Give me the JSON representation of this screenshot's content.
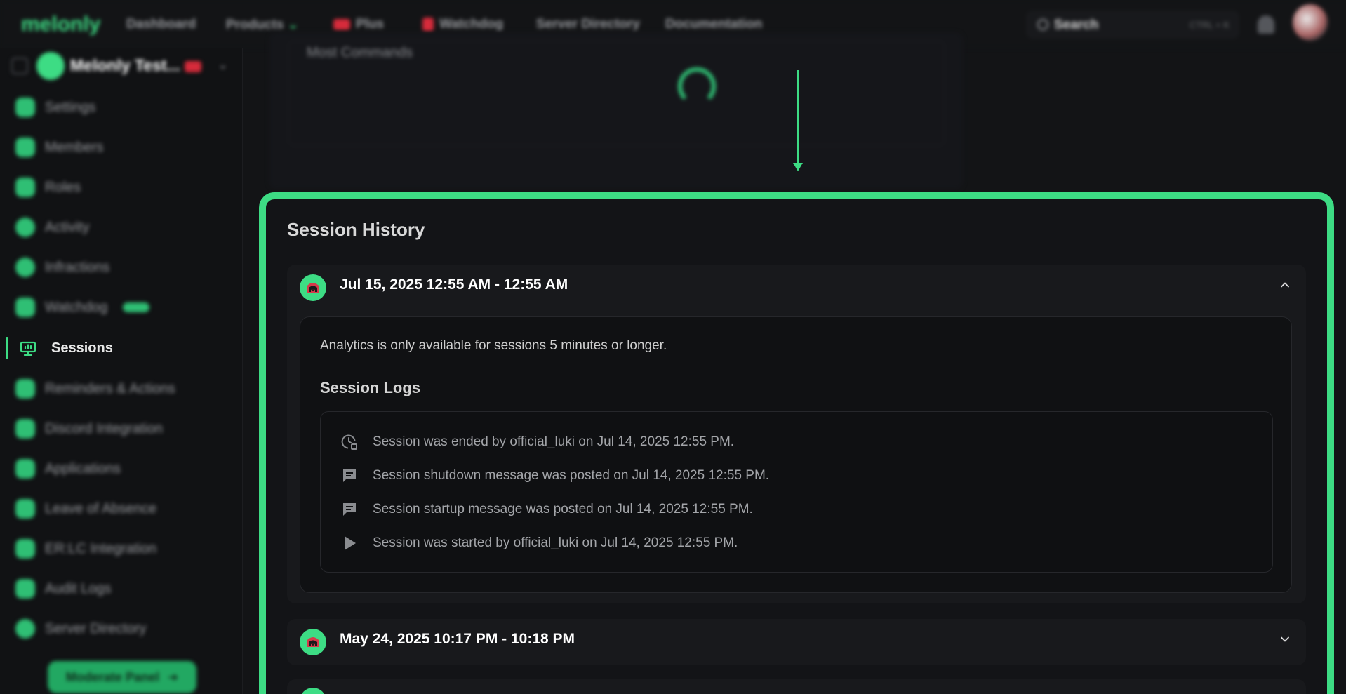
{
  "topbar": {
    "logo": "melonly",
    "nav": [
      "Dashboard",
      "Products",
      "Plus",
      "Watchdog",
      "Server Directory",
      "Documentation"
    ],
    "search_label": "Search",
    "search_shortcut": "CTRL + K"
  },
  "sidebar": {
    "server_name": "Melonly Test...",
    "items": [
      {
        "label": "Settings"
      },
      {
        "label": "Members"
      },
      {
        "label": "Roles"
      },
      {
        "label": "Activity"
      },
      {
        "label": "Infractions"
      },
      {
        "label": "Watchdog",
        "badge": "NEW"
      },
      {
        "label": "Sessions",
        "active": true
      },
      {
        "label": "Reminders & Actions"
      },
      {
        "label": "Discord Integration"
      },
      {
        "label": "Applications"
      },
      {
        "label": "Leave of Absence"
      },
      {
        "label": "ER:LC Integration"
      },
      {
        "label": "Audit Logs"
      },
      {
        "label": "Server Directory"
      }
    ],
    "moderate_button": "Moderate Panel"
  },
  "top_card": {
    "label": "Most Commands"
  },
  "session_history": {
    "title": "Session History",
    "sessions": [
      {
        "date_range": "Jul 15, 2025 12:55 AM - 12:55 AM",
        "expanded": true,
        "analytics_note": "Analytics is only available for sessions 5 minutes or longer.",
        "logs_title": "Session Logs",
        "logs": [
          {
            "icon": "clock-stop-icon",
            "text": "Session was ended by official_luki on Jul 14, 2025 12:55 PM."
          },
          {
            "icon": "message-icon",
            "text": "Session shutdown message was posted on Jul 14, 2025 12:55 PM."
          },
          {
            "icon": "message-icon",
            "text": "Session startup message was posted on Jul 14, 2025 12:55 PM."
          },
          {
            "icon": "play-icon",
            "text": "Session was started by official_luki on Jul 14, 2025 12:55 PM."
          }
        ]
      },
      {
        "date_range": "May 24, 2025 10:17 PM - 10:18 PM",
        "expanded": false
      }
    ]
  },
  "colors": {
    "accent": "#3ddc84",
    "background": "#131416",
    "card": "#18191c"
  }
}
